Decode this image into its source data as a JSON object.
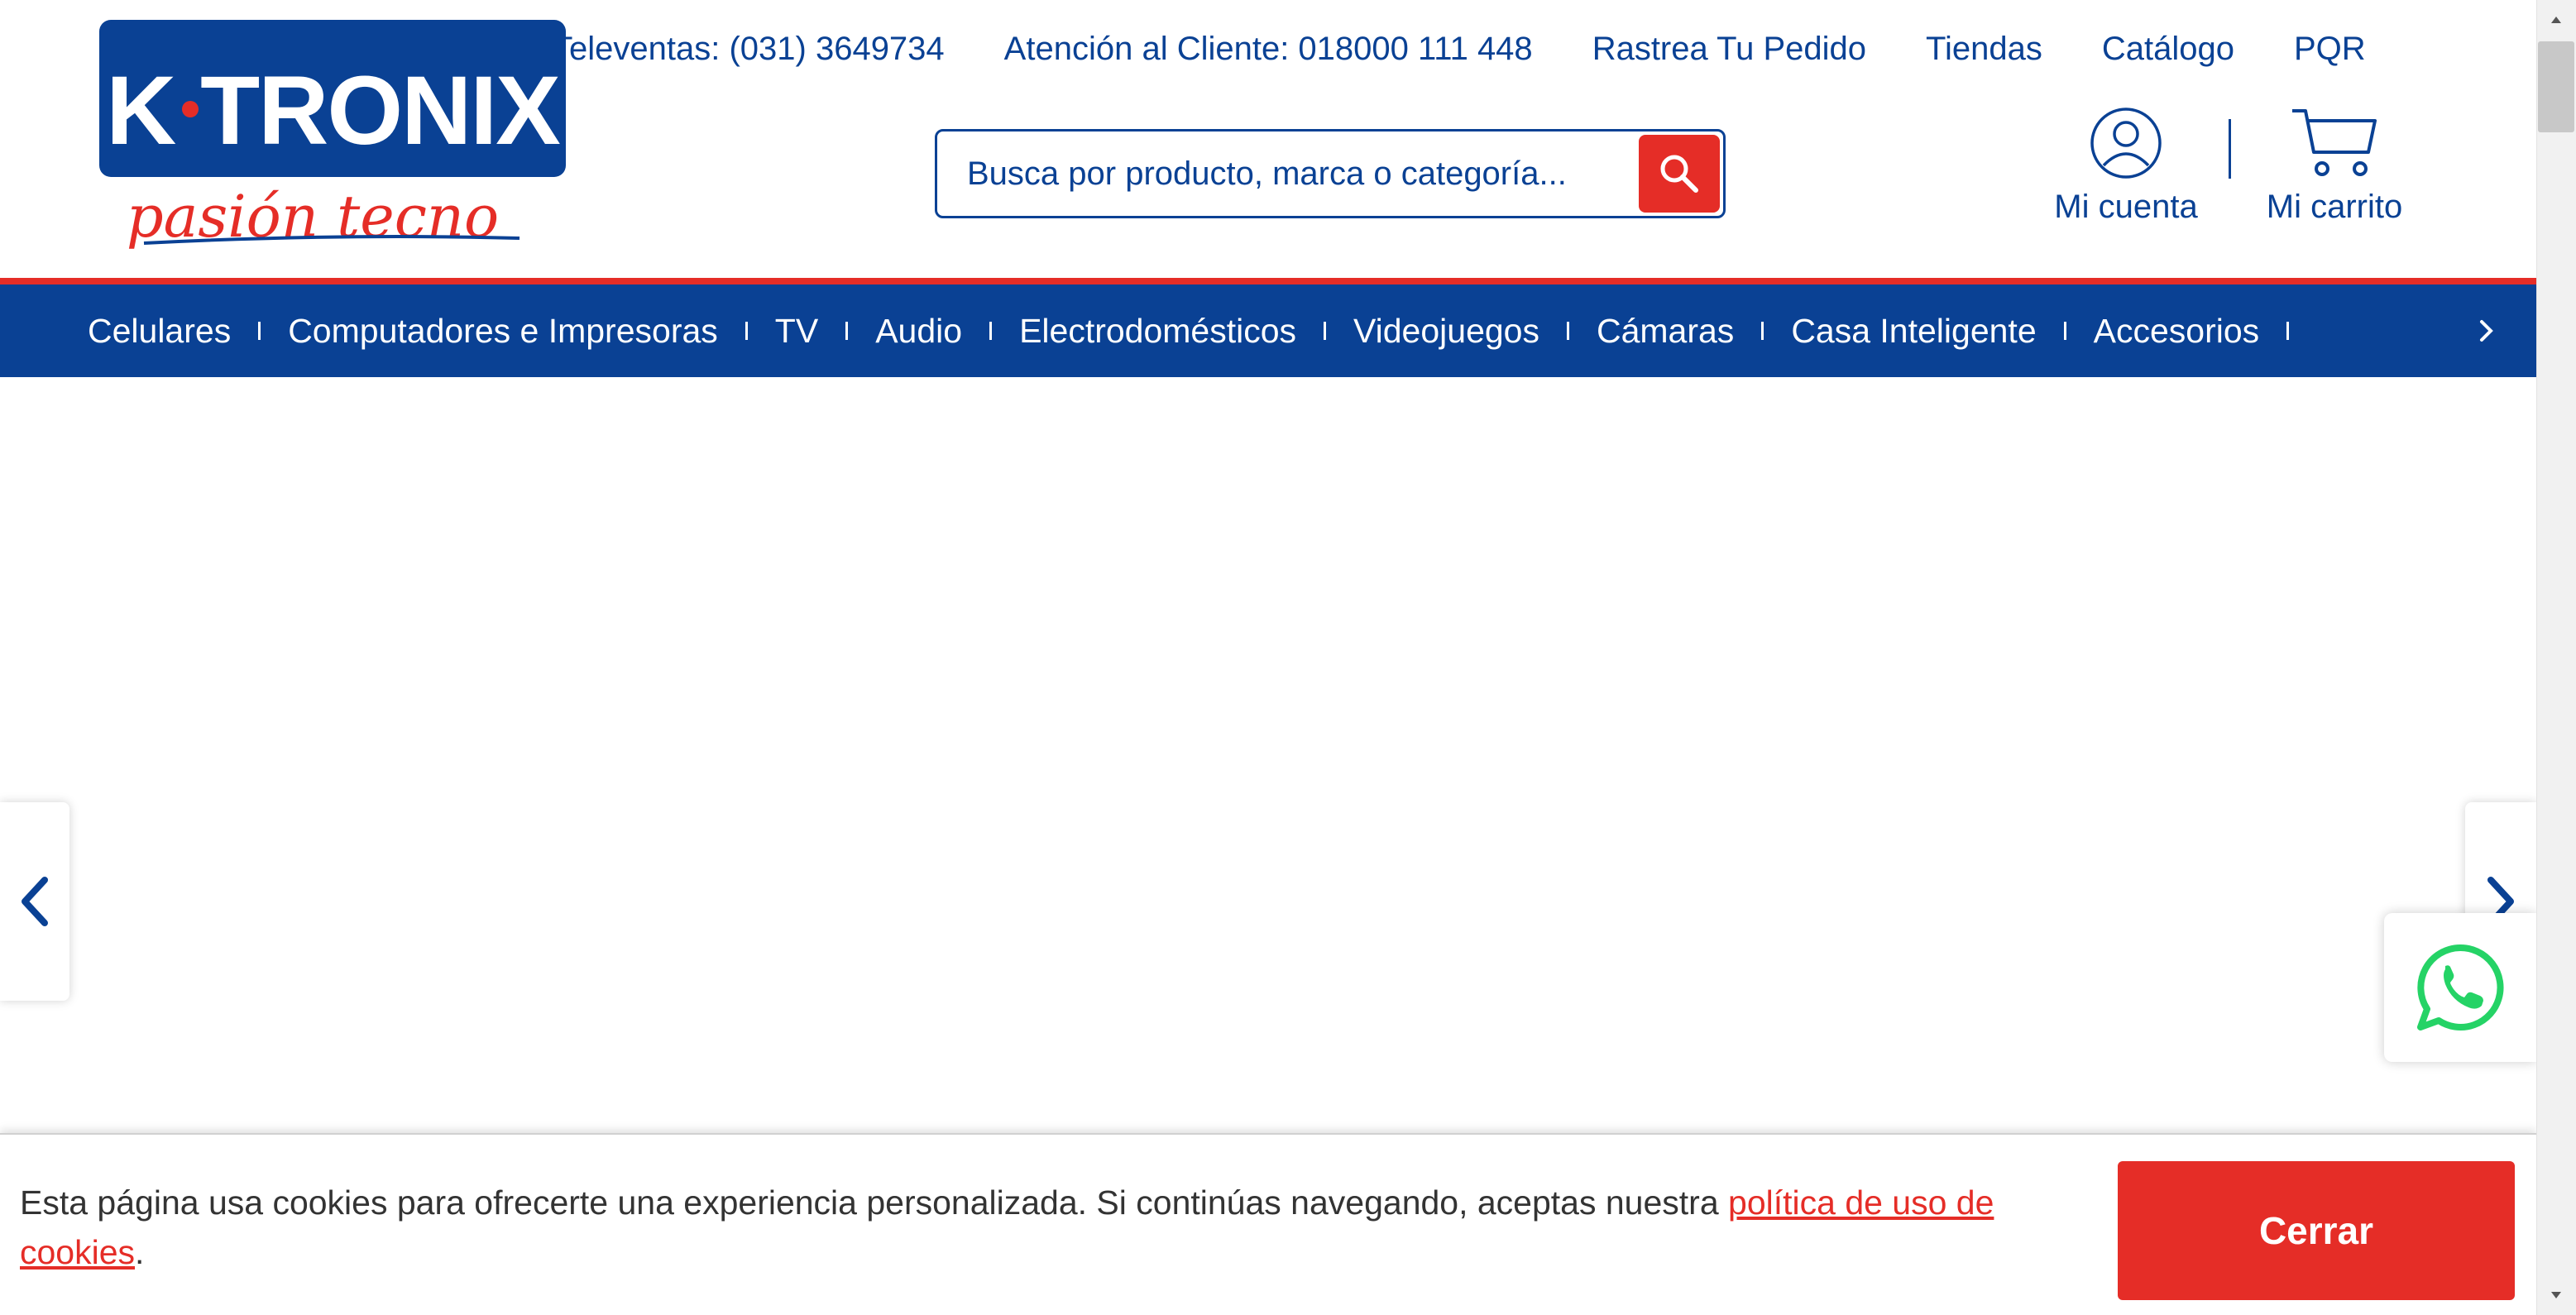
{
  "brand": {
    "logo_text": "K·TRONIX",
    "tagline": "pasión tecno",
    "colors": {
      "primary": "#0a4194",
      "accent": "#e52d27",
      "whatsapp": "#25d366"
    }
  },
  "top_links": [
    {
      "label": "Televentas: (031) 3649734"
    },
    {
      "label": "Atención al Cliente: 018000 111 448"
    },
    {
      "label": "Rastrea Tu Pedido"
    },
    {
      "label": "Tiendas"
    },
    {
      "label": "Catálogo"
    },
    {
      "label": "PQR"
    }
  ],
  "search": {
    "placeholder": "Busca por producto, marca o categoría...",
    "value": "",
    "button_icon": "search-icon"
  },
  "account": {
    "label": "Mi cuenta",
    "icon": "user-icon"
  },
  "cart": {
    "label": "Mi carrito",
    "icon": "cart-icon"
  },
  "nav": {
    "items": [
      {
        "label": "Celulares"
      },
      {
        "label": "Computadores e Impresoras"
      },
      {
        "label": "TV"
      },
      {
        "label": "Audio"
      },
      {
        "label": "Electrodomésticos"
      },
      {
        "label": "Videojuegos"
      },
      {
        "label": "Cámaras"
      },
      {
        "label": "Casa Inteligente"
      },
      {
        "label": "Accesorios"
      }
    ],
    "next_icon": "chevron-right-icon"
  },
  "carousel": {
    "prev_icon": "chevron-left-icon",
    "next_icon": "chevron-right-icon"
  },
  "whatsapp": {
    "icon": "whatsapp-icon"
  },
  "cookie": {
    "message": "Esta página usa cookies para ofrecerte una experiencia personalizada. Si continúas navegando, aceptas nuestra ",
    "link_label": "política de uso de cookies",
    "suffix": ".",
    "close_label": "Cerrar"
  }
}
